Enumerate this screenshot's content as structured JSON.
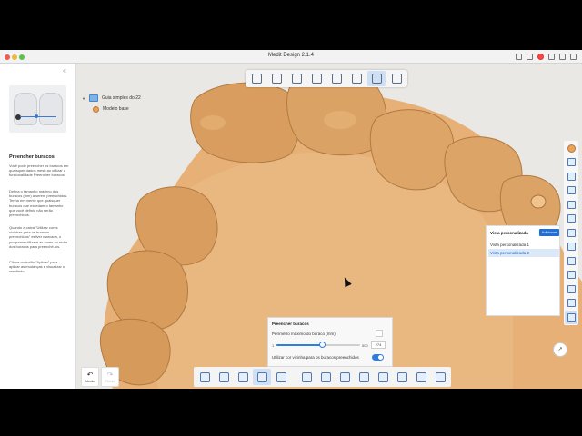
{
  "window": {
    "title": "Medit Design 2.1.4"
  },
  "sidebar": {
    "collapse_icon": "«",
    "heading": "Preencher buracos",
    "paragraphs": [
      "Você pode preencher os buracos em quaisquer dados mesh ao utilizar a funcionalidade Preencher buracos.",
      "Defina o tamanho máximo dos buracos (mm) a serem preenchidos. Tenha em mente que quaisquer buracos que excedam o tamanho que você definiu não serão preenchidos.",
      "Quando a caixa \"Utilizar cores vizinhas para os buracos preenchidos\" estiver marcada, o programa utilizará as cores ao redor dos buracos para preenchê-los.",
      "Clique no botão \"Aplicar\" para aplicar as mudanças e visualizar o resultado."
    ]
  },
  "tree": {
    "group_label": "Guia simples do 22",
    "model_label": "Modelo base"
  },
  "view_panel": {
    "title": "Vista personalizada",
    "add_label": "Adicionar",
    "items": [
      {
        "label": "Vista personalizada 1"
      },
      {
        "label": "Vista personalizada 2"
      }
    ],
    "selected_index": 1
  },
  "fill_panel": {
    "title": "Preencher buracos",
    "perimeter_label": "Perímetro máximo do buraco (mm)",
    "slider_min": "1",
    "slider_max": "500",
    "slider_value": "274",
    "slider_fraction": 0.55,
    "neighbor_color_label": "Utilizar cor vizinha para os buracos preenchidos",
    "neighbor_color_enabled": true
  },
  "undo": {
    "undo_label": "Undo",
    "redo_label": "Redo"
  },
  "compass_glyph": "↗",
  "colors": {
    "accent": "#2f7de1",
    "model": "#e0aa6a",
    "model_shadow": "#c08548"
  }
}
